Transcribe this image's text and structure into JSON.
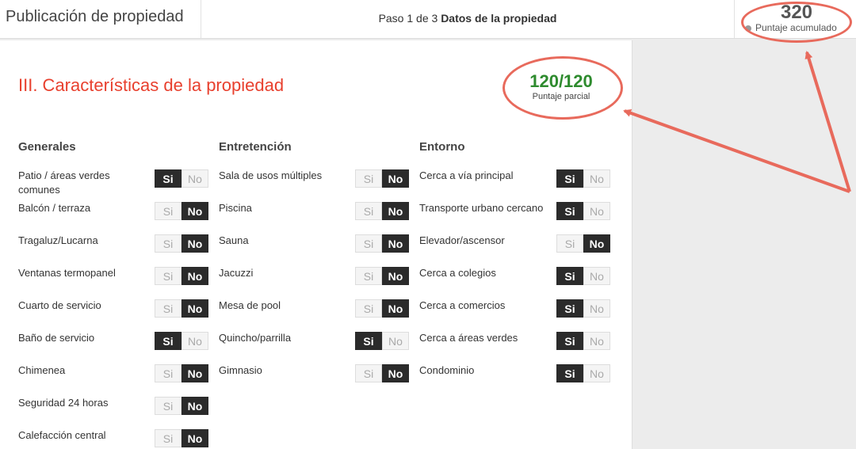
{
  "header": {
    "title": "Publicación de propiedad",
    "step_prefix": "Paso 1 de 3",
    "step_name": "Datos de la propiedad",
    "score_value": "320",
    "score_label": "Puntaje acumulado"
  },
  "section": {
    "title": "III. Características de la propiedad",
    "partial_value": "120/120",
    "partial_label": "Puntaje parcial"
  },
  "toggle_labels": {
    "yes": "Si",
    "no": "No"
  },
  "columns": [
    {
      "heading": "Generales",
      "items": [
        {
          "label": "Patio / áreas verdes comunes",
          "value": "Si"
        },
        {
          "label": "Balcón / terraza",
          "value": "No"
        },
        {
          "label": "Tragaluz/Lucarna",
          "value": "No"
        },
        {
          "label": "Ventanas termopanel",
          "value": "No"
        },
        {
          "label": "Cuarto de servicio",
          "value": "No"
        },
        {
          "label": "Baño de servicio",
          "value": "Si"
        },
        {
          "label": "Chimenea",
          "value": "No"
        },
        {
          "label": "Seguridad 24 horas",
          "value": "No"
        },
        {
          "label": "Calefacción central",
          "value": "No"
        }
      ]
    },
    {
      "heading": "Entretención",
      "items": [
        {
          "label": "Sala de usos múltiples",
          "value": "No"
        },
        {
          "label": "Piscina",
          "value": "No"
        },
        {
          "label": "Sauna",
          "value": "No"
        },
        {
          "label": "Jacuzzi",
          "value": "No"
        },
        {
          "label": "Mesa de pool",
          "value": "No"
        },
        {
          "label": "Quincho/parrilla",
          "value": "Si"
        },
        {
          "label": "Gimnasio",
          "value": "No"
        }
      ]
    },
    {
      "heading": "Entorno",
      "items": [
        {
          "label": "Cerca a vía principal",
          "value": "Si"
        },
        {
          "label": "Transporte urbano cercano",
          "value": "Si"
        },
        {
          "label": "Elevador/ascensor",
          "value": "No"
        },
        {
          "label": "Cerca a colegios",
          "value": "Si"
        },
        {
          "label": "Cerca a comercios",
          "value": "Si"
        },
        {
          "label": "Cerca a áreas verdes",
          "value": "Si"
        },
        {
          "label": "Condominio",
          "value": "Si"
        }
      ]
    }
  ],
  "colors": {
    "accent": "#e8402e",
    "score_green": "#2e8b2e",
    "annotation": "#e86a5c",
    "toggle_on": "#2b2b2b"
  }
}
